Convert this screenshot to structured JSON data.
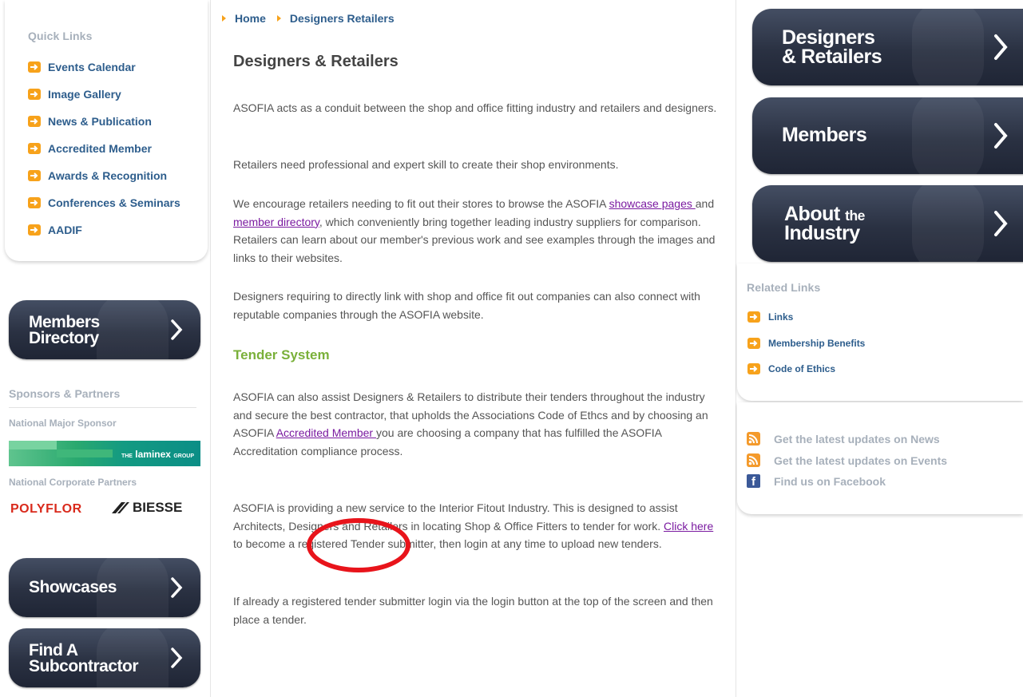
{
  "breadcrumb": {
    "items": [
      "Home",
      "Designers Retailers"
    ]
  },
  "quick_links": {
    "title": "Quick Links",
    "items": [
      "Events Calendar",
      "Image Gallery",
      "News & Publication",
      "Accredited Member",
      "Awards & Recognition",
      "Conferences & Seminars",
      "AADIF"
    ]
  },
  "left_buttons": {
    "members_directory": [
      "Members",
      "Directory"
    ],
    "showcases": "Showcases",
    "find_subcontractor": [
      "Find A",
      "Subcontractor"
    ]
  },
  "sponsors": {
    "title": "Sponsors & Partners",
    "major_label": "National Major Sponsor",
    "laminex_logo": {
      "prefix": "THE",
      "name": "laminex",
      "suffix": "GROUP"
    },
    "corporate_label": "National Corporate Partners",
    "partner_logos": [
      "POLYFLOR",
      "BIESSE"
    ]
  },
  "main": {
    "title": "Designers & Retailers",
    "p1": "ASOFIA acts as a conduit between the shop and office fitting industry and retailers and designers.",
    "p2": "Retailers need professional and expert skill to create their shop environments.",
    "p3_a": "We encourage retailers needing to fit out their stores to browse the ASOFIA ",
    "p3_link1": "showcase pages ",
    "p3_b": "and ",
    "p3_link2": "member directory",
    "p3_c": ", which conveniently bring together leading industry suppliers for comparison. Retailers can learn about our member's previous work and see examples through the images and links to their websites.",
    "p4": "Designers requiring to directly link with shop and office fit out companies can also connect with reputable companies through the ASOFIA website.",
    "subtitle": "Tender System",
    "p5_a": "ASOFIA can also assist Designers & Retailers to distribute their tenders throughout the industry and secure the best contractor, that upholds the Associations Code of Ethcs and by choosing an  ASOFIA ",
    "p5_link": "Accredited Member ",
    "p5_b": "you are choosing a company that has fulfilled the ASOFIA Accreditation compliance process.",
    "p6_a": "ASOFIA is providing a new service to the Interior Fitout Industry. This is designed to assist Architects, Designers and Retailers in locating Shop & Office Fitters to tender for work. ",
    "p6_link": "Click here ",
    "p6_b": "to become a registered Tender submitter, then login at any time to upload new tenders.",
    "p7": "If already a registered tender submitter login via the login button at the top of the screen and then place a tender."
  },
  "right_buttons": {
    "designers": [
      "Designers",
      "& Retailers"
    ],
    "members": "Members",
    "about": {
      "big": "About",
      "small": "the",
      "line2": "Industry"
    }
  },
  "related_links": {
    "title": "Related Links",
    "items": [
      "Links",
      "Membership Benefits",
      "Code of Ethics"
    ]
  },
  "feeds": [
    "Get the latest updates on News",
    "Get the latest updates on Events",
    "Find us on Facebook"
  ],
  "colors": {
    "accent_orange": "#f7a21b",
    "link_blue": "#2d5d8c",
    "green_heading": "#7ab03a",
    "annotation_red": "#e8141b"
  }
}
